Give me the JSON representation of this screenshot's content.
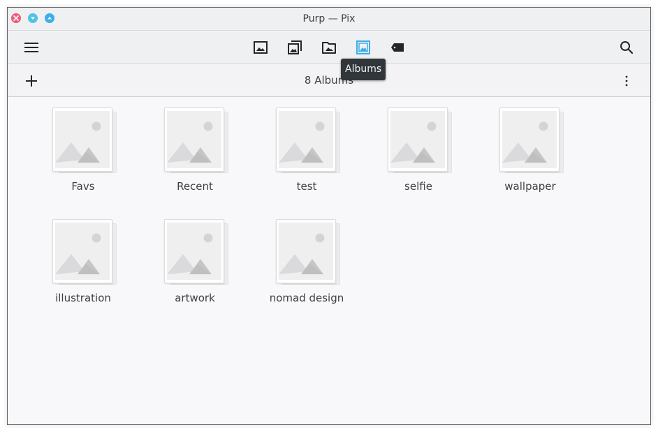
{
  "window": {
    "title": "Purp — Pix",
    "controls": [
      {
        "name": "close-button",
        "icon": "close-icon",
        "color": "#ee5b7a"
      },
      {
        "name": "minimize-button",
        "icon": "chevron-down-icon",
        "color": "#4fc3e6"
      },
      {
        "name": "maximize-button",
        "icon": "chevron-up-icon",
        "color": "#3daee9"
      }
    ]
  },
  "toolbar": {
    "menu_icon": "hamburger-menu-icon",
    "views": [
      {
        "name": "gallery",
        "icon": "image-icon",
        "active": false
      },
      {
        "name": "collections",
        "icon": "images-stack-icon",
        "active": false
      },
      {
        "name": "folders",
        "icon": "folder-image-icon",
        "active": false
      },
      {
        "name": "albums",
        "icon": "album-icon",
        "active": true
      },
      {
        "name": "tags",
        "icon": "tag-icon",
        "active": false
      }
    ],
    "search_icon": "search-icon",
    "accent_color": "#3daee9",
    "tooltip": "Albums"
  },
  "subbar": {
    "add_icon": "plus-icon",
    "title": "8 Albums",
    "more_icon": "kebab-menu-icon"
  },
  "albums": [
    {
      "name": "Favs"
    },
    {
      "name": "Recent"
    },
    {
      "name": "test"
    },
    {
      "name": "selfie"
    },
    {
      "name": "wallpaper"
    },
    {
      "name": "illustration"
    },
    {
      "name": "artwork"
    },
    {
      "name": "nomad design"
    }
  ]
}
